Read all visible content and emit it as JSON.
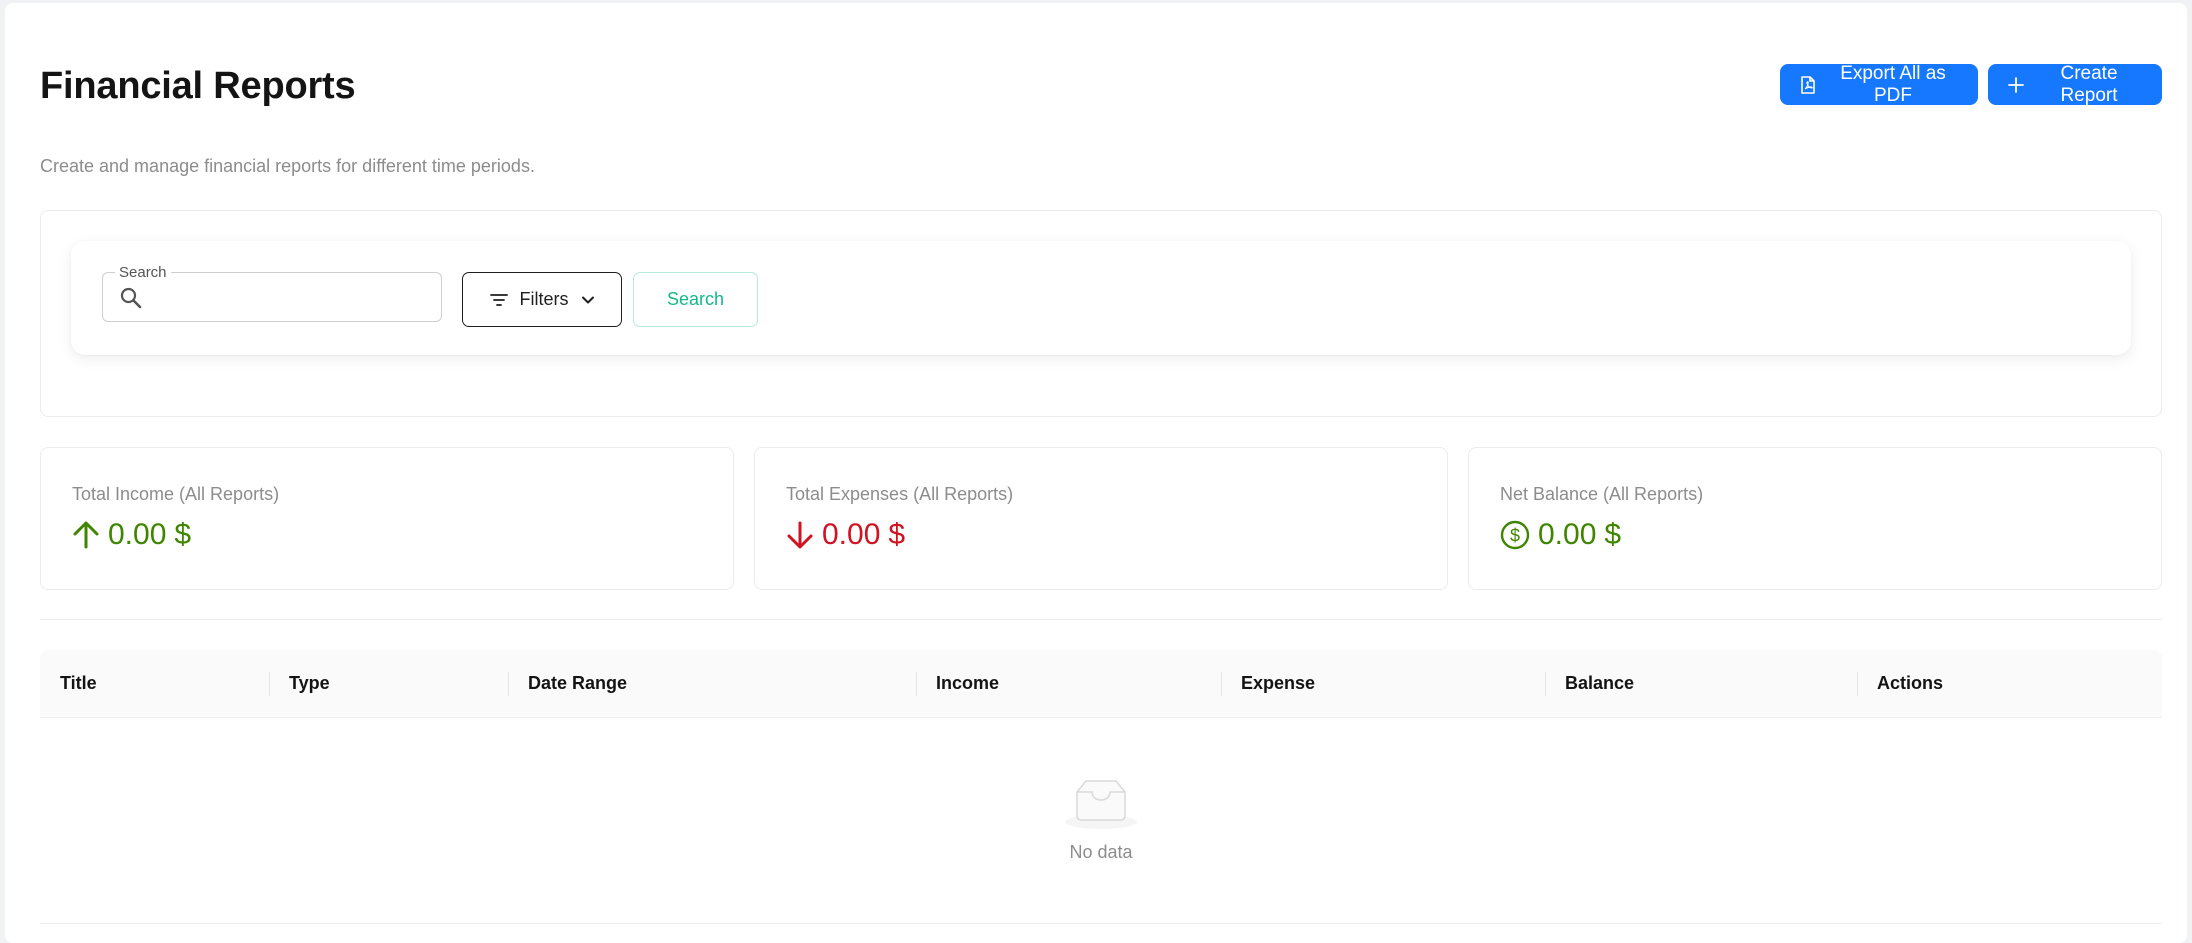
{
  "header": {
    "title": "Financial Reports",
    "subtitle": "Create and manage financial reports for different time periods.",
    "export_label": "Export All as PDF",
    "create_label": "Create Report"
  },
  "search": {
    "field_label": "Search",
    "value": "",
    "filters_label": "Filters",
    "search_button_label": "Search"
  },
  "stats": [
    {
      "label": "Total Income (All Reports)",
      "amount": "0.00",
      "currency": "$",
      "icon": "arrow-up-icon",
      "color": "#3f8600"
    },
    {
      "label": "Total Expenses (All Reports)",
      "amount": "0.00",
      "currency": "$",
      "icon": "arrow-down-icon",
      "color": "#cf1322"
    },
    {
      "label": "Net Balance (All Reports)",
      "amount": "0.00",
      "currency": "$",
      "icon": "dollar-circle-icon",
      "color": "#3f8600"
    }
  ],
  "table": {
    "columns": [
      "Title",
      "Type",
      "Date Range",
      "Income",
      "Expense",
      "Balance",
      "Actions"
    ],
    "rows": [],
    "empty_text": "No data"
  },
  "colors": {
    "primary": "#1677ff",
    "success": "#3f8600",
    "danger": "#cf1322",
    "search_accent": "#13b88a"
  }
}
